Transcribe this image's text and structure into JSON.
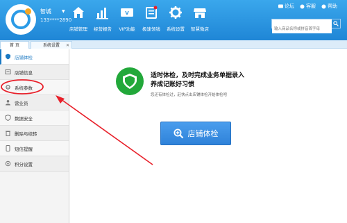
{
  "header": {
    "shop_name": "智城",
    "shop_phone": "133****2890",
    "nav": [
      {
        "label": "店铺管理",
        "icon": "shop-icon"
      },
      {
        "label": "经营报告",
        "icon": "bar-chart-icon"
      },
      {
        "label": "VIP功能",
        "icon": "vip-card-icon"
      },
      {
        "label": "极速领钱",
        "icon": "list-icon"
      },
      {
        "label": "系统设置",
        "icon": "gear-icon"
      },
      {
        "label": "智慧微店",
        "icon": "store-icon"
      }
    ],
    "top_links": [
      {
        "label": "论坛",
        "icon": "forum-icon"
      },
      {
        "label": "客服",
        "icon": "headset-icon"
      },
      {
        "label": "帮助",
        "icon": "help-icon"
      }
    ],
    "search_placeholder": "输入商品名称或拼音首字母"
  },
  "tabs": [
    {
      "label": "首 页"
    },
    {
      "label": "系统设置"
    }
  ],
  "sidebar": {
    "items": [
      {
        "label": "店铺体检",
        "icon": "shield-check-icon"
      },
      {
        "label": "店铺信息",
        "icon": "store-info-icon"
      },
      {
        "label": "系统参数",
        "icon": "gear-icon"
      },
      {
        "label": "营业员",
        "icon": "person-icon"
      },
      {
        "label": "数据安全",
        "icon": "shield-icon"
      },
      {
        "label": "删除与结转",
        "icon": "delete-icon"
      },
      {
        "label": "短信提醒",
        "icon": "sms-icon"
      },
      {
        "label": "积分设置",
        "icon": "points-icon"
      }
    ]
  },
  "main": {
    "headline_line1": "适时体检，及时完成业务单据录入",
    "headline_line2": "养成记账好习惯",
    "subtext": "您还有体检过，赶快点击店铺体检开始体检吧",
    "button_label": "店铺体检"
  },
  "colors": {
    "header": "#2a95e0",
    "accent": "#1a78c2",
    "shield": "#22a83a",
    "annotation": "#e8202a"
  }
}
